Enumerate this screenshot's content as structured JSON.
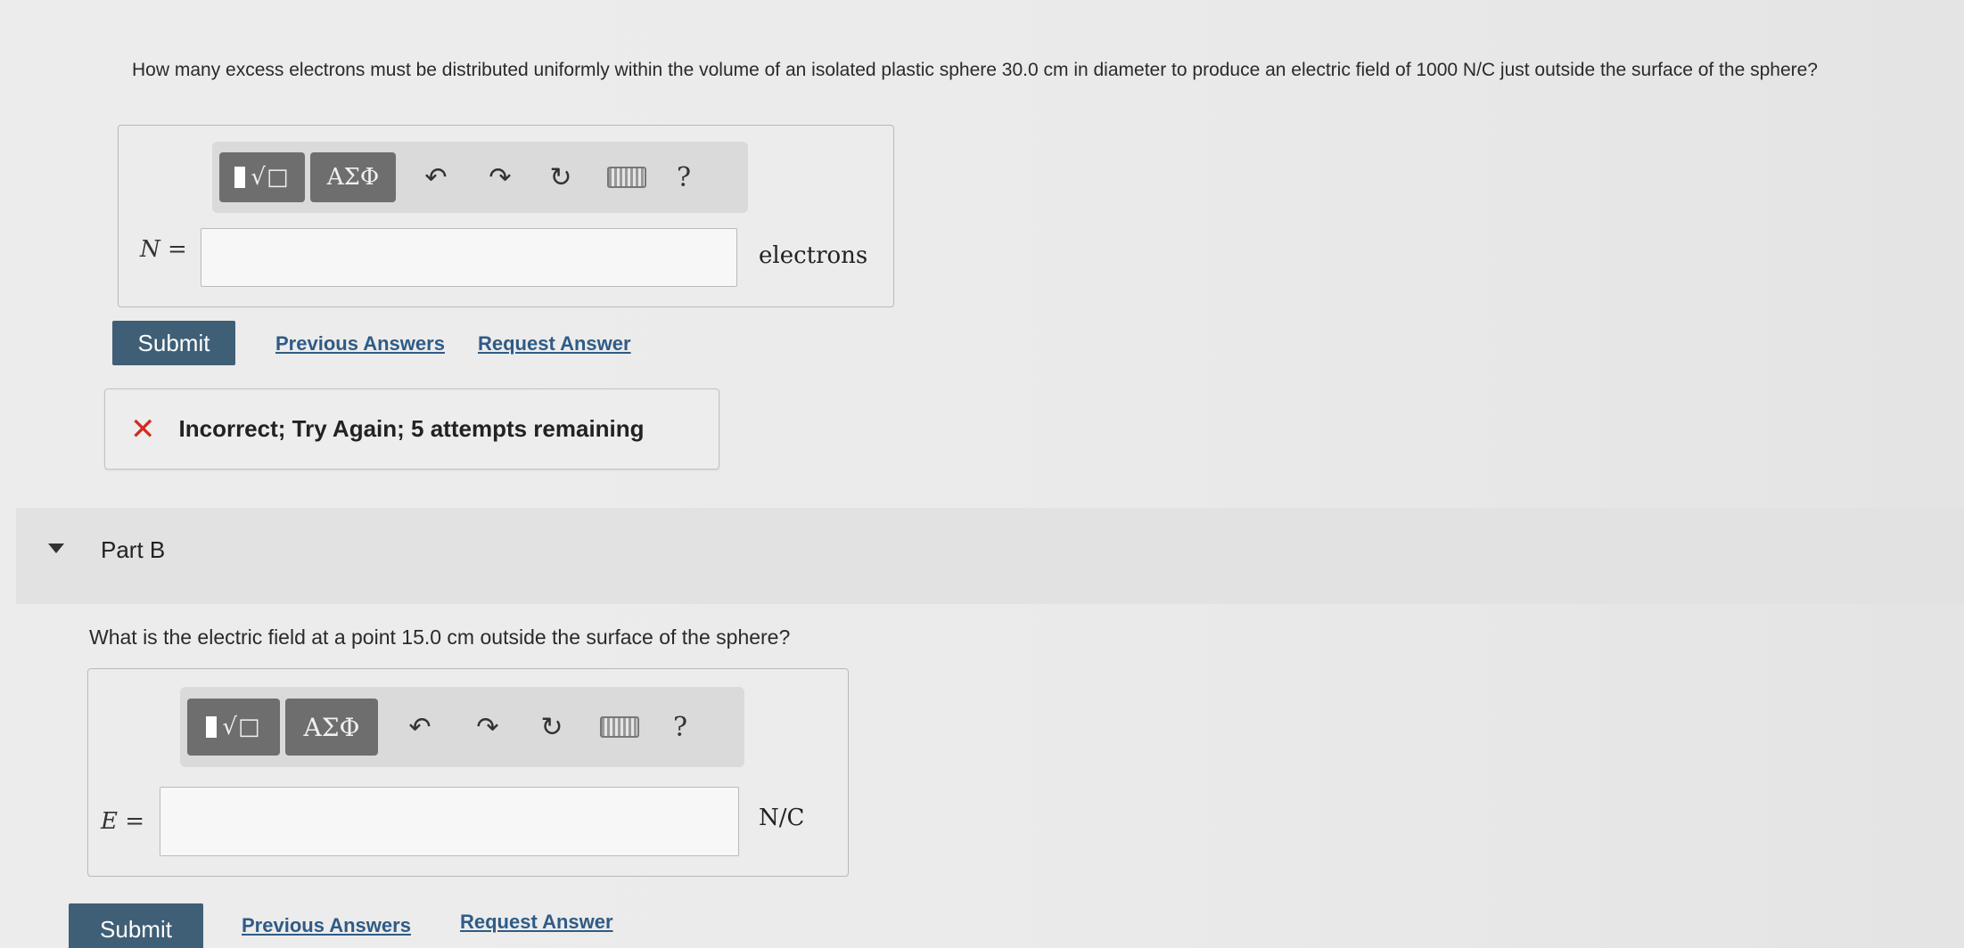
{
  "partA": {
    "question": "How many excess electrons must be distributed uniformly within the volume of an isolated plastic sphere 30.0 cm in diameter to produce an electric field of 1000 N/C just outside the surface of the sphere?",
    "toolbar": {
      "templates_label": "√□",
      "greek_label": "ΑΣΦ",
      "undo_icon": "undo-icon",
      "redo_icon": "redo-icon",
      "reset_icon": "reset-icon",
      "keyboard_icon": "keyboard-icon",
      "help_label": "?"
    },
    "variable": "N",
    "equals": "=",
    "input_value": "",
    "unit": "electrons",
    "submit_label": "Submit",
    "previous_answers_label": "Previous Answers",
    "request_answer_label": "Request Answer",
    "feedback": {
      "icon": "x-mark-icon",
      "message": "Incorrect; Try Again; 5 attempts remaining",
      "color": "#d22b22"
    }
  },
  "partB": {
    "header": "Part B",
    "question": "What is the electric field at a point 15.0 cm outside the surface of the sphere?",
    "toolbar": {
      "templates_label": "√□",
      "greek_label": "ΑΣΦ",
      "help_label": "?"
    },
    "variable": "E",
    "equals": "=",
    "input_value": "",
    "unit": "N/C",
    "submit_label": "Submit",
    "previous_answers_label": "Previous Answers",
    "request_answer_label": "Request Answer"
  },
  "colors": {
    "submit_bg": "#3f5f76",
    "link": "#2f5b86",
    "toolbar_btn": "#6e6e6e"
  }
}
